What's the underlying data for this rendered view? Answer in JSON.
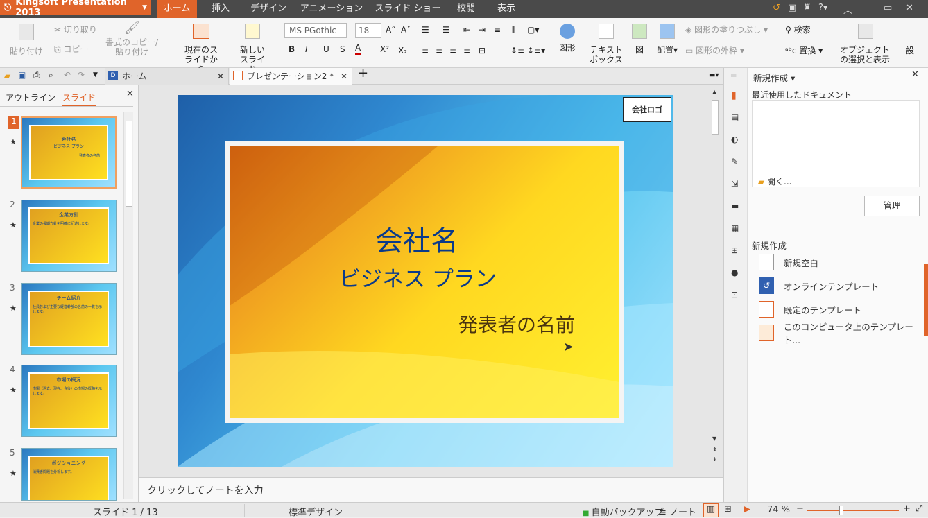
{
  "app": {
    "title": "Kingsoft Presentation 2013"
  },
  "menu": [
    "ホーム",
    "挿入",
    "デザイン",
    "アニメーション",
    "スライド ショー",
    "校閲",
    "表示"
  ],
  "ribbon": {
    "paste": "貼り付け",
    "cut": "切り取り",
    "copy": "コピー",
    "format_copy": "書式のコピー/貼り付け",
    "from_current": "現在のスライドから",
    "new_slide": "新しいスライド",
    "font_name": "MS PGothic",
    "font_size": "18",
    "shape": "図形",
    "textbox": "テキストボックス",
    "picture": "図",
    "arrange": "配置",
    "shape_fill": "図形の塗りつぶし",
    "shape_outline": "図形の外枠",
    "find": "検索",
    "replace": "置換",
    "select_objects": "オブジェクトの選択と表示",
    "settings_partial": "設"
  },
  "tabs": [
    {
      "label": "ホーム"
    },
    {
      "label": "プレゼンテーション2 *"
    }
  ],
  "leftpane": {
    "tab_outline": "アウトライン",
    "tab_slides": "スライド",
    "slides": [
      {
        "num": "1",
        "title": "会社名",
        "sub": "ビジネス プラン",
        "extra": "発表者の名前"
      },
      {
        "num": "2",
        "title": "企業方針",
        "sub": "企業の長期方針を明確に記述します。"
      },
      {
        "num": "3",
        "title": "チーム紹介",
        "sub": "社員および主要な経営幹部の名前の一覧を示します。"
      },
      {
        "num": "4",
        "title": "市場の概況",
        "sub": "市場（過去、現在、今後）の市場の概略を示します。"
      },
      {
        "num": "5",
        "title": "ポジショニング",
        "sub": "消費者問題を分析します。"
      }
    ]
  },
  "slide": {
    "logo": "会社ロゴ",
    "title": "会社名",
    "subtitle": "ビジネス プラン",
    "presenter": "発表者の名前"
  },
  "notes": {
    "placeholder": "クリックしてノートを入力"
  },
  "panel": {
    "header": "新規作成",
    "recent": "最近使用したドキュメント",
    "open": "開く...",
    "manage": "管理",
    "new_section": "新規作成",
    "items": [
      "新規空白",
      "オンラインテンプレート",
      "既定のテンプレート",
      "このコンピュータ上のテンプレート..."
    ]
  },
  "status": {
    "slide_pos": "スライド 1 / 13",
    "design": "標準デザイン",
    "backup": "自動バックアップ",
    "notes": "ノート",
    "zoom": "74 %"
  },
  "colors": {
    "accent": "#e0642a",
    "titlebar": "#4a4a4a",
    "slide_text": "#0a3a8a"
  }
}
